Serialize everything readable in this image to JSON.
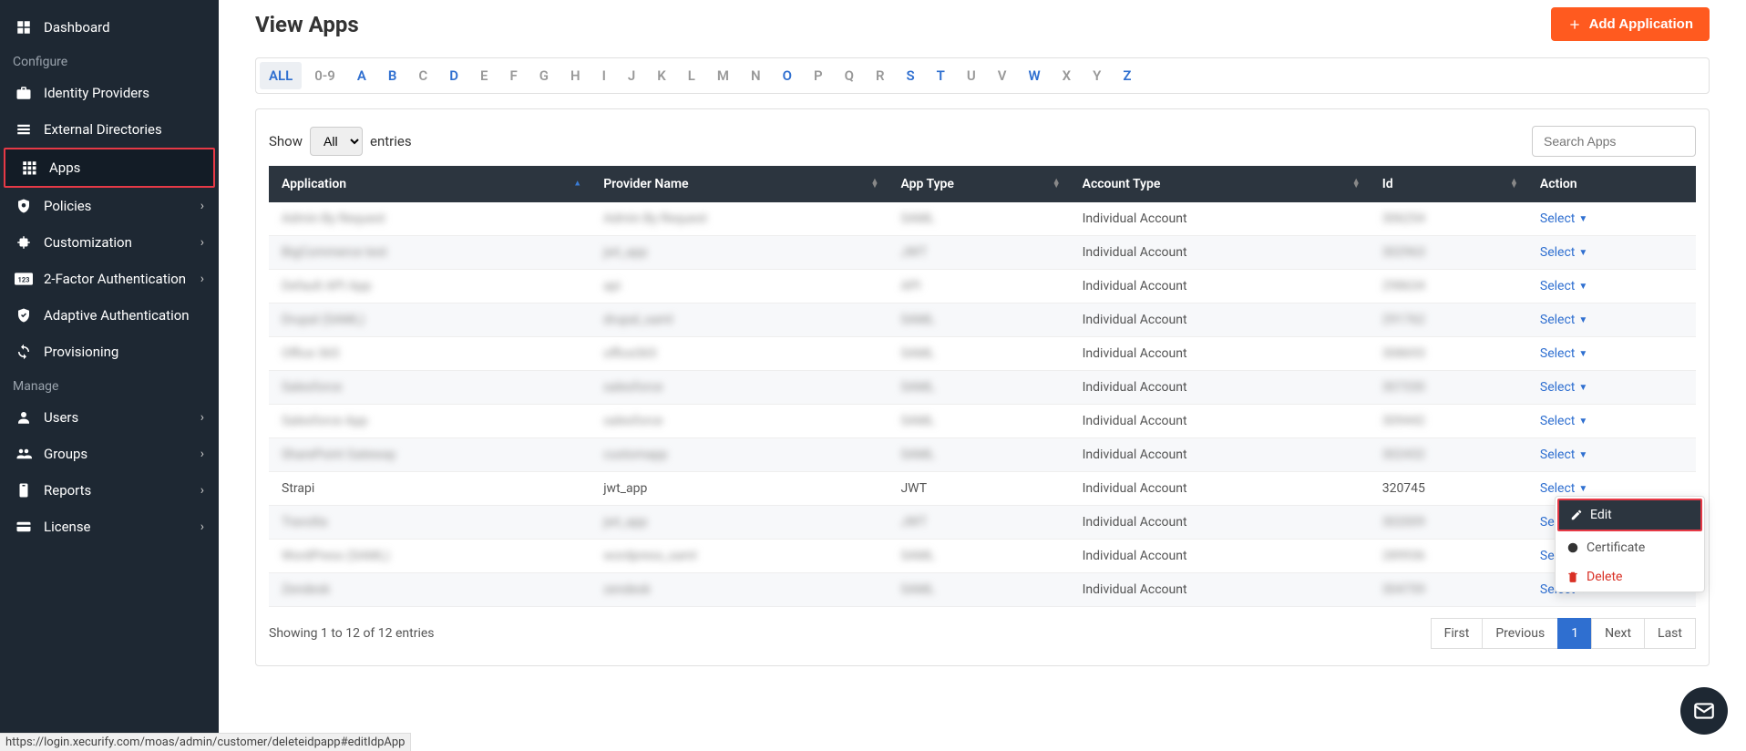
{
  "sidebar": {
    "items": [
      {
        "label": "Dashboard",
        "chev": false
      },
      {
        "heading": "Configure"
      },
      {
        "label": "Identity Providers",
        "chev": false
      },
      {
        "label": "External Directories",
        "chev": false
      },
      {
        "label": "Apps",
        "chev": false,
        "active": true
      },
      {
        "label": "Policies",
        "chev": true
      },
      {
        "label": "Customization",
        "chev": true
      },
      {
        "label": "2-Factor Authentication",
        "chev": true
      },
      {
        "label": "Adaptive Authentication",
        "chev": false
      },
      {
        "label": "Provisioning",
        "chev": false
      },
      {
        "heading": "Manage"
      },
      {
        "label": "Users",
        "chev": true
      },
      {
        "label": "Groups",
        "chev": true
      },
      {
        "label": "Reports",
        "chev": true
      },
      {
        "label": "License",
        "chev": true
      }
    ]
  },
  "page": {
    "title": "View Apps",
    "add_button": "Add Application"
  },
  "alpha": {
    "letters": [
      "ALL",
      "0-9",
      "A",
      "B",
      "C",
      "D",
      "E",
      "F",
      "G",
      "H",
      "I",
      "J",
      "K",
      "L",
      "M",
      "N",
      "O",
      "P",
      "Q",
      "R",
      "S",
      "T",
      "U",
      "V",
      "W",
      "X",
      "Y",
      "Z"
    ],
    "active": "ALL",
    "has_data": [
      "A",
      "B",
      "D",
      "O",
      "S",
      "T",
      "W",
      "Z"
    ]
  },
  "table": {
    "show_label_pre": "Show",
    "show_label_post": "entries",
    "show_value": "All",
    "search_placeholder": "Search Apps",
    "columns": [
      "Application",
      "Provider Name",
      "App Type",
      "Account Type",
      "Id",
      "Action"
    ],
    "action_label": "Select",
    "rows": [
      {
        "app": "Admin By Request",
        "provider": "Admin By Request",
        "type": "SAML",
        "acct": "Individual Account",
        "id": "306254",
        "blur": true
      },
      {
        "app": "BigCommerce test",
        "provider": "jwt_app",
        "type": "JWT",
        "acct": "Individual Account",
        "id": "302963",
        "blur": true
      },
      {
        "app": "Default API App",
        "provider": "api",
        "type": "API",
        "acct": "Individual Account",
        "id": "298634",
        "blur": true
      },
      {
        "app": "Drupal (SAML)",
        "provider": "drupal_saml",
        "type": "SAML",
        "acct": "Individual Account",
        "id": "291762",
        "blur": true
      },
      {
        "app": "Office 365",
        "provider": "office365",
        "type": "SAML",
        "acct": "Individual Account",
        "id": "308693",
        "blur": true
      },
      {
        "app": "Salesforce",
        "provider": "salesforce",
        "type": "SAML",
        "acct": "Individual Account",
        "id": "307330",
        "blur": true
      },
      {
        "app": "Salesforce App",
        "provider": "salesforce",
        "type": "SAML",
        "acct": "Individual Account",
        "id": "309442",
        "blur": true
      },
      {
        "app": "SharePoint Gateway",
        "provider": "customapp",
        "type": "SAML",
        "acct": "Individual Account",
        "id": "302432",
        "blur": true
      },
      {
        "app": "Strapi",
        "provider": "jwt_app",
        "type": "JWT",
        "acct": "Individual Account",
        "id": "320745",
        "blur": false,
        "menu_open": true
      },
      {
        "app": "Travolta",
        "provider": "jwt_app",
        "type": "JWT",
        "acct": "Individual Account",
        "id": "302009",
        "blur": true
      },
      {
        "app": "WordPress (SAML)",
        "provider": "wordpress_saml",
        "type": "SAML",
        "acct": "Individual Account",
        "id": "289936",
        "blur": true
      },
      {
        "app": "Zendesk",
        "provider": "zendesk",
        "type": "SAML",
        "acct": "Individual Account",
        "id": "304759",
        "blur": true
      }
    ],
    "dropdown": {
      "edit": "Edit",
      "certificate": "Certificate",
      "delete": "Delete"
    },
    "info_text": "Showing 1 to 12 of 12 entries",
    "pagination": [
      "First",
      "Previous",
      "1",
      "Next",
      "Last"
    ],
    "active_page": "1"
  },
  "status_url": "https://login.xecurify.com/moas/admin/customer/deleteidpapp#editIdpApp"
}
